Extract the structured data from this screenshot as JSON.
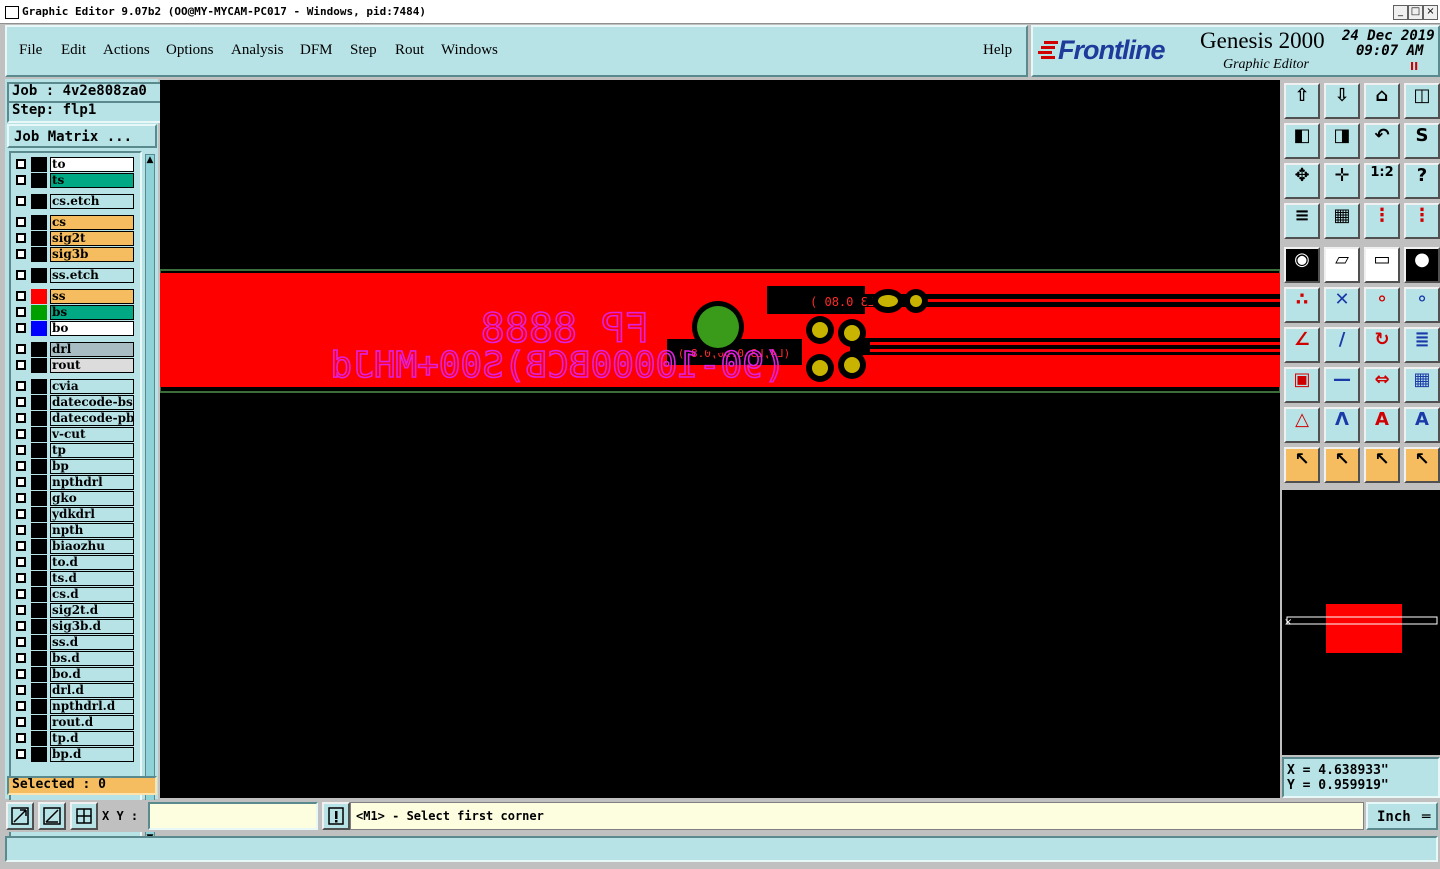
{
  "window": {
    "title": "Graphic Editor 9.07b2  (OO@MY-MYCAM-PC017 - Windows, pid:7484)",
    "minimize": "_",
    "maximize": "□",
    "close": "×"
  },
  "menu": {
    "items": [
      "File",
      "Edit",
      "Actions",
      "Options",
      "Analysis",
      "DFM",
      "Step",
      "Rout",
      "Windows"
    ],
    "help": "Help"
  },
  "brand": {
    "logo": "Frontline",
    "product": "Genesis 2000",
    "subtitle": "Graphic Editor",
    "date": "24 Dec 2019",
    "time": "09:07 AM",
    "status_mark": "II"
  },
  "job": {
    "job_label": "Job : 4v2e808za0",
    "step_label": "Step: flp1",
    "matrix_button": "Job Matrix ...",
    "selected": "Selected : 0"
  },
  "layers": [
    {
      "name": "to",
      "swatch": "#000000",
      "bg": "#ffffff"
    },
    {
      "name": "ts",
      "swatch": "#000000",
      "bg": "#00a884"
    },
    {
      "name": "cs.etch",
      "swatch": "#000000",
      "bg": "#b7e3e7"
    },
    {
      "name": "cs",
      "swatch": "#000000",
      "bg": "#f5bd60"
    },
    {
      "name": "sig2t",
      "swatch": "#000000",
      "bg": "#f5bd60"
    },
    {
      "name": "sig3b",
      "swatch": "#000000",
      "bg": "#f5bd60"
    },
    {
      "name": "ss.etch",
      "swatch": "#000000",
      "bg": "#b7e3e7"
    },
    {
      "name": "ss",
      "swatch": "#ff0000",
      "bg": "#f5bd60"
    },
    {
      "name": "bs",
      "swatch": "#00a000",
      "bg": "#00a884"
    },
    {
      "name": "bo",
      "swatch": "#0000ff",
      "bg": "#ffffff"
    },
    {
      "name": "drl",
      "swatch": "#000000",
      "bg": "#a8bcc4"
    },
    {
      "name": "rout",
      "swatch": "#000000",
      "bg": "#dcdcdc"
    },
    {
      "name": "cvia",
      "swatch": "#000000",
      "bg": "#b7e3e7"
    },
    {
      "name": "datecode-bs",
      "swatch": "#000000",
      "bg": "#b7e3e7"
    },
    {
      "name": "datecode-pbo",
      "swatch": "#000000",
      "bg": "#b7e3e7"
    },
    {
      "name": "v-cut",
      "swatch": "#000000",
      "bg": "#b7e3e7"
    },
    {
      "name": "tp",
      "swatch": "#000000",
      "bg": "#b7e3e7"
    },
    {
      "name": "bp",
      "swatch": "#000000",
      "bg": "#b7e3e7"
    },
    {
      "name": "npthdrl",
      "swatch": "#000000",
      "bg": "#b7e3e7"
    },
    {
      "name": "gko",
      "swatch": "#000000",
      "bg": "#b7e3e7"
    },
    {
      "name": "ydkdrl",
      "swatch": "#000000",
      "bg": "#b7e3e7"
    },
    {
      "name": "npth",
      "swatch": "#000000",
      "bg": "#b7e3e7"
    },
    {
      "name": "biaozhu",
      "swatch": "#000000",
      "bg": "#b7e3e7"
    },
    {
      "name": "to.d",
      "swatch": "#000000",
      "bg": "#b7e3e7"
    },
    {
      "name": "ts.d",
      "swatch": "#000000",
      "bg": "#b7e3e7"
    },
    {
      "name": "cs.d",
      "swatch": "#000000",
      "bg": "#b7e3e7"
    },
    {
      "name": "sig2t.d",
      "swatch": "#000000",
      "bg": "#b7e3e7"
    },
    {
      "name": "sig3b.d",
      "swatch": "#000000",
      "bg": "#b7e3e7"
    },
    {
      "name": "ss.d",
      "swatch": "#000000",
      "bg": "#b7e3e7"
    },
    {
      "name": "bs.d",
      "swatch": "#000000",
      "bg": "#b7e3e7"
    },
    {
      "name": "bo.d",
      "swatch": "#000000",
      "bg": "#b7e3e7"
    },
    {
      "name": "drl.d",
      "swatch": "#000000",
      "bg": "#b7e3e7"
    },
    {
      "name": "npthdrl.d",
      "swatch": "#000000",
      "bg": "#b7e3e7"
    },
    {
      "name": "rout.d",
      "swatch": "#000000",
      "bg": "#b7e3e7"
    },
    {
      "name": "tp.d",
      "swatch": "#000000",
      "bg": "#b7e3e7"
    },
    {
      "name": "bp.d",
      "swatch": "#000000",
      "bg": "#b7e3e7"
    }
  ],
  "canvas": {
    "silk_top": "FP 8888",
    "silk_bottom": "(90-10000BCB)S00+MHJd",
    "pad_label_1": "(L4,L3 0.80 )",
    "pad_label_2": "(L4,L3 0.50,0.8 )",
    "colors": {
      "board": "#ff0000",
      "silk": "#e020e0",
      "pad": "#c8b400",
      "via": "#3a9a1a",
      "background": "#000000"
    }
  },
  "coords": {
    "x": "X = 4.638933\"",
    "y": "Y = 0.959919\""
  },
  "bottom": {
    "xy_label": "X Y :",
    "xy_value": "",
    "prompt": "<M1> - Select first corner",
    "unit": "Inch"
  }
}
